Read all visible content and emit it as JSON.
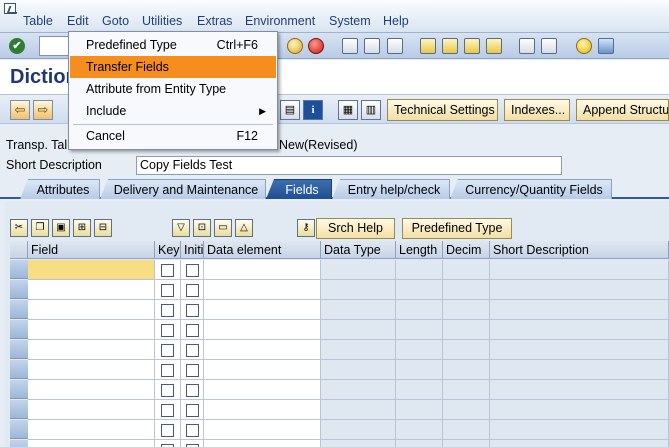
{
  "menubar": {
    "items": [
      "Table",
      "Edit",
      "Goto",
      "Utilities",
      "Extras",
      "Environment",
      "System",
      "Help"
    ]
  },
  "title": "Diction",
  "app_toolbar": {
    "technical_settings": "Technical Settings",
    "indexes": "Indexes...",
    "append_structure": "Append Structur"
  },
  "header": {
    "transp_table_label": "Transp. Tal",
    "status": "New(Revised)",
    "short_description_label": "Short Description",
    "short_description_value": "Copy Fields Test"
  },
  "tabs": [
    "Attributes",
    "Delivery and Maintenance",
    "Fields",
    "Entry help/check",
    "Currency/Quantity Fields"
  ],
  "table_toolbar": {
    "srch_help": "Srch Help",
    "predefined_type": "Predefined Type"
  },
  "table": {
    "columns": [
      "Field",
      "Key",
      "Initi",
      "Data element",
      "Data Type",
      "Length",
      "Decim",
      "Short Description"
    ]
  },
  "dropdown": {
    "items": [
      {
        "label": "Predefined Type",
        "shortcut": "Ctrl+F6"
      },
      {
        "label": "Transfer Fields",
        "shortcut": ""
      },
      {
        "label": "Attribute from Entity Type",
        "shortcut": ""
      },
      {
        "label": "Include",
        "shortcut": ""
      },
      {
        "label": "Cancel",
        "shortcut": "F12"
      }
    ]
  },
  "colors": {
    "highlight": "#f68d1f",
    "active_tab": "#2a5a96",
    "title": "#22386b"
  }
}
